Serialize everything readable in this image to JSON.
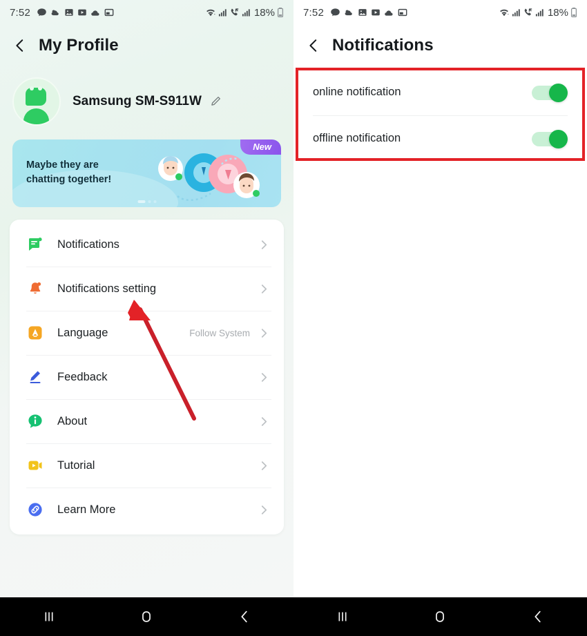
{
  "left_screen": {
    "status_bar": {
      "time": "7:52",
      "battery": "18%",
      "left_icons": [
        "chat-bubble-icon",
        "weather-cloud-icon",
        "gallery-image-icon",
        "video-play-icon",
        "cloud-icon",
        "picture-in-picture-icon"
      ],
      "right_icons": [
        "wifi-icon",
        "signal-bars-icon",
        "missed-call-icon",
        "signal-bars-icon",
        "battery-icon"
      ]
    },
    "appbar": {
      "title": "My Profile",
      "back_icon": "chevron-left-icon"
    },
    "profile": {
      "name": "Samsung SM-S911W",
      "avatar_icon": "robot-avatar-icon",
      "edit_icon": "pencil-edit-icon"
    },
    "banner": {
      "line1": "Maybe they are",
      "line2": "chatting together!",
      "badge": "New",
      "art_icon": "chat-people-illustration"
    },
    "menu": [
      {
        "label": "Notifications",
        "icon": "chat-notification-icon",
        "value": "",
        "color": "#2ecc62"
      },
      {
        "label": "Notifications setting",
        "icon": "bell-icon",
        "value": "",
        "color": "#ef6c33"
      },
      {
        "label": "Language",
        "icon": "language-a-icon",
        "value": "Follow System",
        "color": "#f5a623"
      },
      {
        "label": "Feedback",
        "icon": "pencil-feedback-icon",
        "value": "",
        "color": "#3b5bdb"
      },
      {
        "label": "About",
        "icon": "info-icon",
        "value": "",
        "color": "#16c172"
      },
      {
        "label": "Tutorial",
        "icon": "video-tutorial-icon",
        "value": "",
        "color": "#f2c31a"
      },
      {
        "label": "Learn More",
        "icon": "link-chain-icon",
        "value": "",
        "color": "#4a6ef0"
      }
    ]
  },
  "right_screen": {
    "status_bar": {
      "time": "7:52",
      "battery": "18%"
    },
    "appbar": {
      "title": "Notifications",
      "back_icon": "chevron-left-icon"
    },
    "rows": [
      {
        "label": "online notification",
        "toggle": "on"
      },
      {
        "label": "offline notification",
        "toggle": "on"
      }
    ]
  },
  "annotations": {
    "highlight_color": "#e32227",
    "arrow_target": "Notifications setting"
  },
  "nav_bar": {
    "recents_icon": "recents-icon",
    "home_icon": "home-icon",
    "back_icon": "nav-back-icon"
  }
}
